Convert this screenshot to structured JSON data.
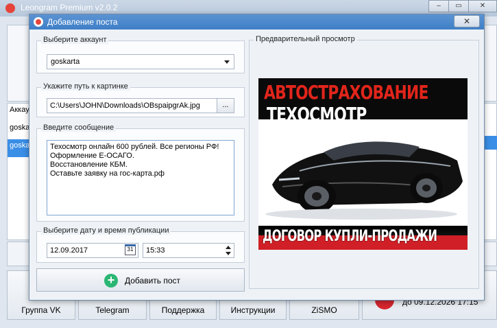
{
  "app": {
    "title": "Leongram Premium v2.0.2",
    "window_controls": [
      "–",
      "▭",
      "✕"
    ],
    "list_items": [
      "Аккау",
      "goskar",
      "goskar"
    ],
    "bottom_buttons": [
      {
        "label": "Группа VK"
      },
      {
        "label": "Telegram"
      },
      {
        "label": "Поддержка"
      },
      {
        "label": "Инструкции"
      },
      {
        "label": "ZiSMO"
      }
    ],
    "subscription_text": "до 09.12.2026 17:15"
  },
  "dialog": {
    "title": "Добавление поста",
    "close_label": "✕",
    "account_group": {
      "title": "Выберите аккаунт",
      "selected": "goskarta"
    },
    "image_group": {
      "title": "Укажите путь к картинке",
      "path": "C:\\Users\\JOHN\\Downloads\\OBspaipgrAk.jpg",
      "browse_label": "..."
    },
    "message_group": {
      "title": "Введите сообщение",
      "lines": [
        "Техосмотр онлайн 600 рублей. Все регионы РФ!",
        "Оформление Е-ОСАГО.",
        "Восстановление КБМ.",
        "Оставьте заявку на гос-карта.рф"
      ]
    },
    "schedule_group": {
      "title": "Выберите дату и время публикации",
      "date": "12.09.2017",
      "calendar_day": "31",
      "time": "15:33"
    },
    "add_button_label": "Добавить пост",
    "preview_group": {
      "title": "Предварительный просмотр",
      "image_text": {
        "line1": "АВТОСТРАХОВАНИЕ",
        "line2": "ТЕХОСМОТР",
        "line3": "ДОГОВОР КУПЛИ-ПРОДАЖИ"
      }
    }
  },
  "colors": {
    "dialog_title_bg": "#4a88cc",
    "add_icon": "#2bb673",
    "brand_red": "#e1251b",
    "selection": "#3a8ee6"
  }
}
